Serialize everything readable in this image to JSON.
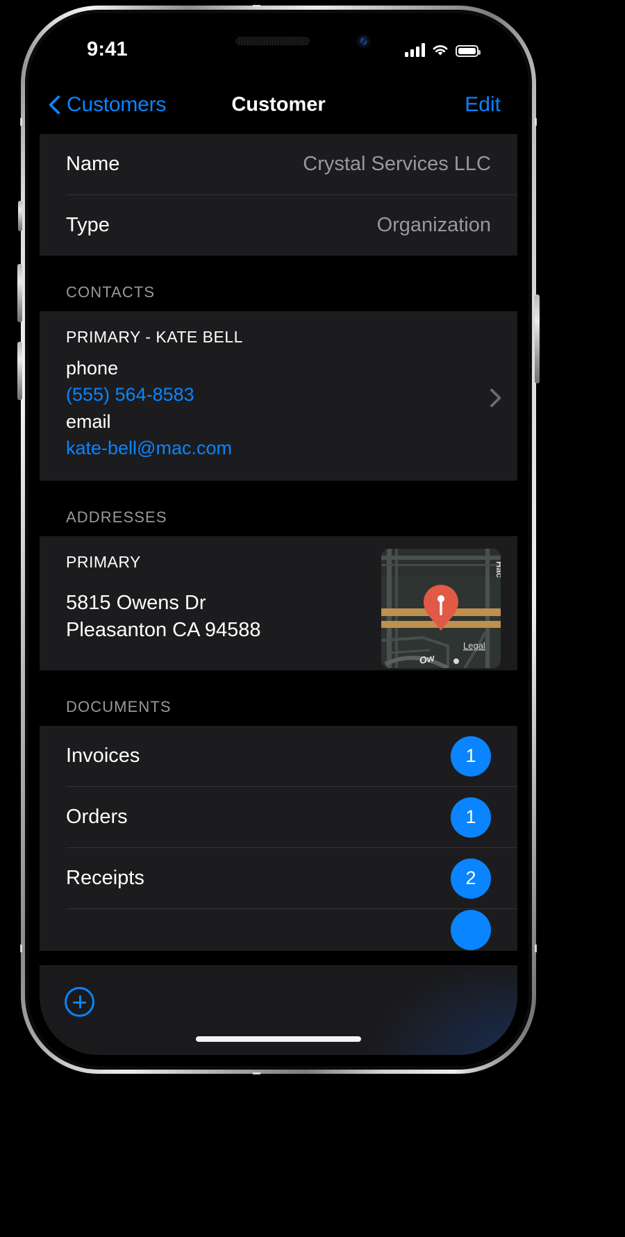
{
  "status_bar": {
    "time": "9:41",
    "cellular_icon": "cellular-bars-icon",
    "wifi_icon": "wifi-icon",
    "battery_icon": "battery-icon"
  },
  "nav": {
    "back_label": "Customers",
    "back_icon": "chevron-left-icon",
    "title": "Customer",
    "edit_label": "Edit"
  },
  "details": {
    "rows": [
      {
        "label": "Name",
        "value": "Crystal Services LLC"
      },
      {
        "label": "Type",
        "value": "Organization"
      }
    ]
  },
  "contacts": {
    "header": "CONTACTS",
    "items": [
      {
        "title": "PRIMARY - KATE BELL",
        "phone_label": "phone",
        "phone_value": "(555) 564-8583",
        "email_label": "email",
        "email_value": "kate-bell@mac.com",
        "disclosure_icon": "chevron-right-icon"
      }
    ]
  },
  "addresses": {
    "header": "ADDRESSES",
    "items": [
      {
        "title": "PRIMARY",
        "line1": "5815 Owens Dr",
        "line2": "Pleasanton CA 94588",
        "map_icon": "map-thumbnail",
        "map_pin_icon": "map-pin-icon",
        "map_labels": {
          "top_right": "Hac",
          "legal": "Legal",
          "street": "Ow"
        }
      }
    ]
  },
  "documents": {
    "header": "DOCUMENTS",
    "items": [
      {
        "label": "Invoices",
        "count": "1"
      },
      {
        "label": "Orders",
        "count": "1"
      },
      {
        "label": "Receipts",
        "count": "2"
      }
    ]
  },
  "toolbar": {
    "add_icon": "plus-circle-icon",
    "add_label": "Add"
  },
  "colors": {
    "accent_blue": "#0a84ff",
    "group_bg": "#1c1c1e",
    "page_bg": "#000000",
    "secondary_text": "#98989f",
    "pin_red": "#e05a45"
  }
}
